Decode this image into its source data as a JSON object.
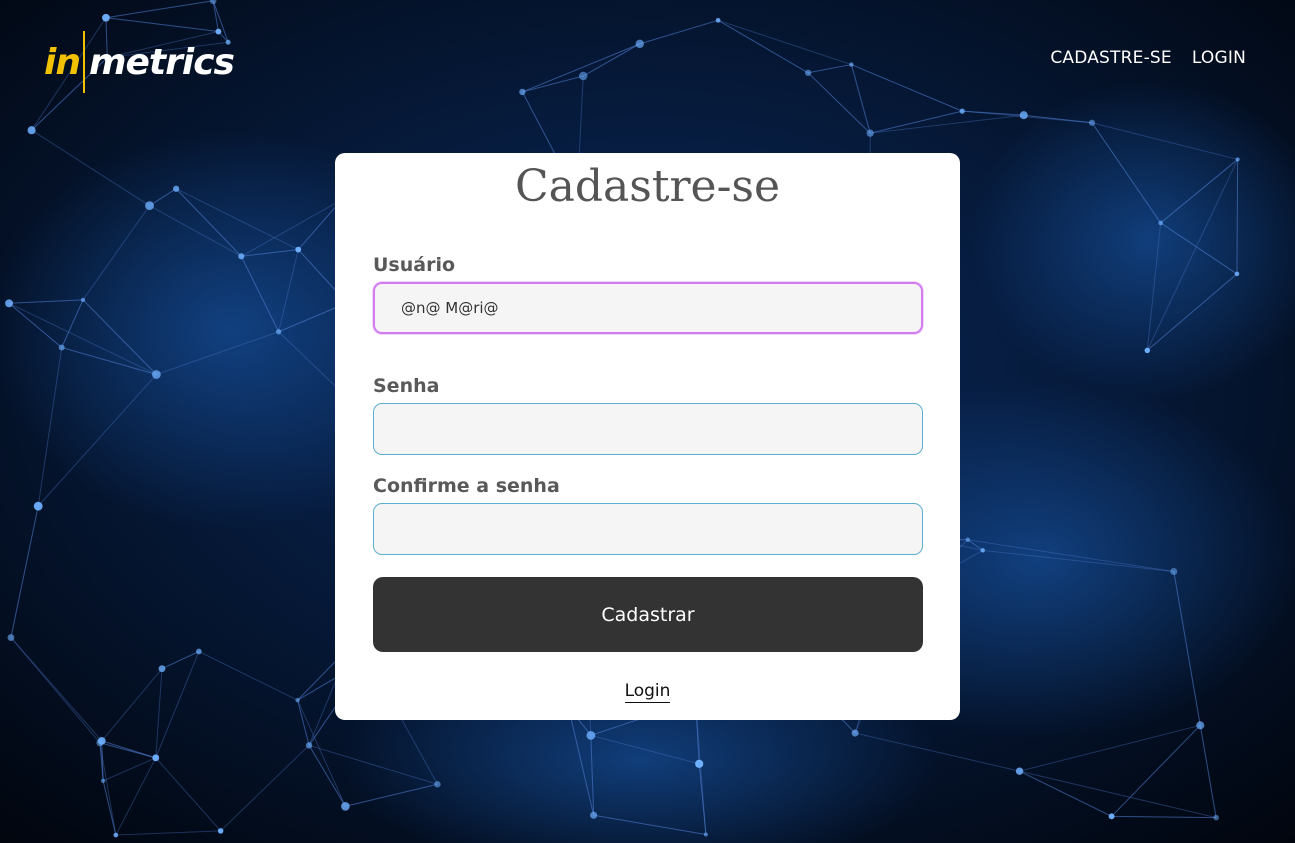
{
  "header": {
    "logo_in": "in",
    "logo_metrics": "metrics",
    "nav": {
      "signup_label": "CADASTRE-SE",
      "login_label": "LOGIN"
    }
  },
  "form": {
    "title": "Cadastre-se",
    "username": {
      "label": "Usuário",
      "value": "@n@ M@ri@"
    },
    "password": {
      "label": "Senha",
      "value": ""
    },
    "confirm_password": {
      "label": "Confirme a senha",
      "value": ""
    },
    "submit_label": "Cadastrar",
    "login_link_label": "Login"
  },
  "colors": {
    "accent_logo": "#f2c200",
    "card_bg": "#ffffff",
    "button_bg": "#333333",
    "input_border": "#5aaed0",
    "focus_border": "#d27cf0"
  }
}
